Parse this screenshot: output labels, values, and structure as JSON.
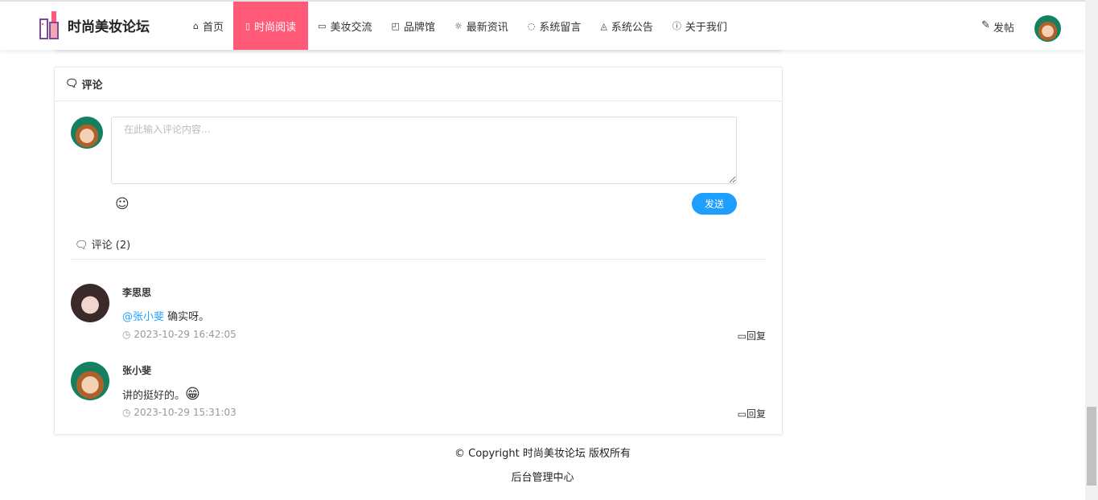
{
  "site": {
    "title": "时尚美妆论坛"
  },
  "menu": [
    {
      "icon": "⌂",
      "label": "首页"
    },
    {
      "icon": "▯",
      "label": "时尚阅读"
    },
    {
      "icon": "▭",
      "label": "美妆交流"
    },
    {
      "icon": "◰",
      "label": "品牌馆"
    },
    {
      "icon": "☼",
      "label": "最新资讯"
    },
    {
      "icon": "◌",
      "label": "系统留言"
    },
    {
      "icon": "◬",
      "label": "系统公告"
    },
    {
      "icon": "ⓘ",
      "label": "关于我们"
    }
  ],
  "header": {
    "post_label": "发帖"
  },
  "comments_section": {
    "title": "评论",
    "placeholder": "在此输入评论内容...",
    "send_label": "发送",
    "count_label": "评论 (2)"
  },
  "comments": [
    {
      "name": "李思思",
      "mention": "@张小斐",
      "text": "确实呀。",
      "time": "2023-10-29 16:42:05",
      "reply": "回复"
    },
    {
      "name": "张小斐",
      "mention": "",
      "text": "讲的挺好的。",
      "emoji": "😁",
      "time": "2023-10-29 15:31:03",
      "reply": "回复"
    }
  ],
  "footer": {
    "copyright": "© Copyright 时尚美妆论坛 版权所有",
    "admin": "后台管理中心"
  }
}
